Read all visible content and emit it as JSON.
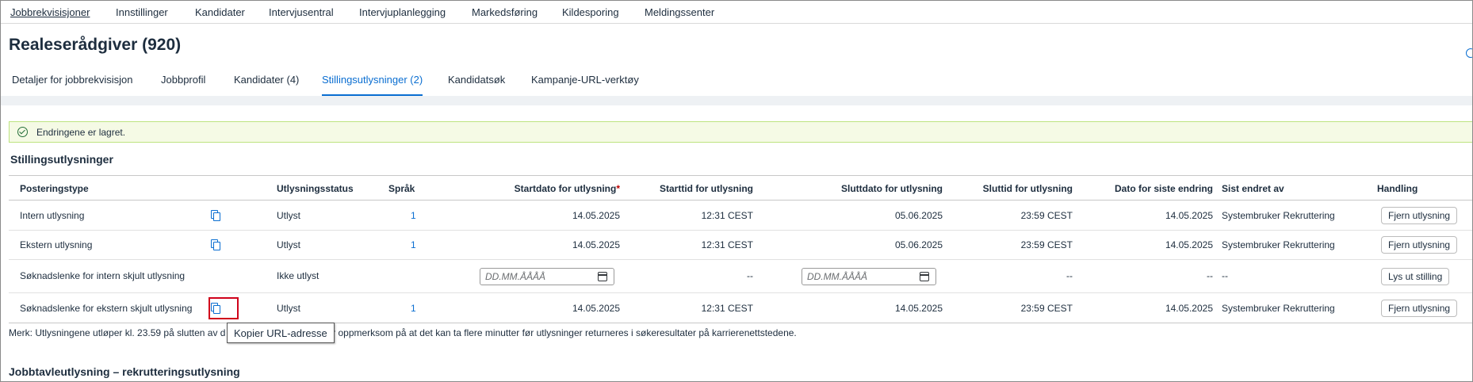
{
  "topnav": {
    "items": [
      "Jobbrekvisisjoner",
      "Innstillinger",
      "Kandidater",
      "Intervjusentral",
      "Intervjuplanlegging",
      "Markedsføring",
      "Kildesporing",
      "Meldingssenter"
    ]
  },
  "page": {
    "title": "Realeserådgiver (920)"
  },
  "tabs": [
    "Detaljer for jobbrekvisisjon",
    "Jobbprofil",
    "Kandidater (4)",
    "Stillingsutlysninger (2)",
    "Kandidatsøk",
    "Kampanje-URL-verktøy"
  ],
  "active_tab": "Stillingsutlysninger (2)",
  "message": {
    "text": "Endringene er lagret."
  },
  "section": {
    "title": "Stillingsutlysninger"
  },
  "table": {
    "headers": {
      "type": "Posteringstype",
      "status": "Utlysningsstatus",
      "lang": "Språk",
      "start_date": "Startdato for utlysning",
      "start_date_req": "*",
      "start_time": "Starttid for utlysning",
      "end_date": "Sluttdato for utlysning",
      "end_time": "Sluttid for utlysning",
      "last_change": "Dato for siste endring",
      "changed_by": "Sist endret av",
      "action": "Handling"
    },
    "rows": [
      {
        "type": "Intern utlysning",
        "status": "Utlyst",
        "lang": "1",
        "start_date": "14.05.2025",
        "start_time": "12:31 CEST",
        "end_date": "05.06.2025",
        "end_time": "23:59 CEST",
        "last_change": "14.05.2025",
        "changed_by": "Systembruker Rekruttering",
        "action": "Fjern utlysning"
      },
      {
        "type": "Ekstern utlysning",
        "status": "Utlyst",
        "lang": "1",
        "start_date": "14.05.2025",
        "start_time": "12:31 CEST",
        "end_date": "05.06.2025",
        "end_time": "23:59 CEST",
        "last_change": "14.05.2025",
        "changed_by": "Systembruker Rekruttering",
        "action": "Fjern utlysning"
      },
      {
        "type": "Søknadslenke for intern skjult utlysning",
        "status": "Ikke utlyst",
        "start_placeholder": "DD.MM.ÅÅÅÅ",
        "start_time": "--",
        "end_placeholder": "DD.MM.ÅÅÅÅ",
        "end_time": "--",
        "last_change": "--",
        "changed_by": "--",
        "action": "Lys ut stilling"
      },
      {
        "type": "Søknadslenke for ekstern skjult utlysning",
        "status": "Utlyst",
        "lang": "1",
        "start_date": "14.05.2025",
        "start_time": "12:31 CEST",
        "end_date": "14.05.2025",
        "end_time": "23:59 CEST",
        "last_change": "14.05.2025",
        "changed_by": "Systembruker Rekruttering",
        "action": "Fjern utlysning"
      }
    ]
  },
  "note": {
    "left": "Merk: Utlysningene utløper kl. 23.59 på slutten av d",
    "right": "er oppmerksom på at det kan ta flere minutter før utlysninger returneres i søkeresultater på karrierenettstedene."
  },
  "tooltip": {
    "text": "Kopier URL-adresse"
  },
  "section2": {
    "title": "Jobbtavleutlysning – rekrutteringsutlysning"
  },
  "colors": {
    "accent": "#0a6ed1",
    "highlight": "#d0021b",
    "success_bg": "#f5fae5"
  },
  "icons": [
    "copy-icon",
    "calendar-icon",
    "check-circle-icon",
    "info-icon"
  ]
}
